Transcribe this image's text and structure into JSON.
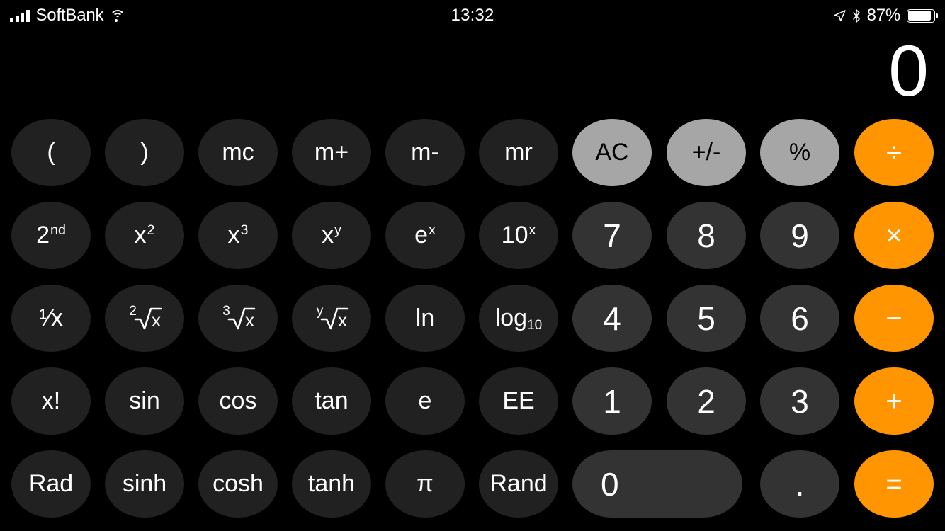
{
  "status_bar": {
    "carrier": "SoftBank",
    "time": "13:32",
    "battery_percent": "87%",
    "icons": [
      "signal-bars-icon",
      "wifi-icon",
      "location-arrow-icon",
      "bluetooth-icon",
      "battery-icon"
    ]
  },
  "display": {
    "value": "0"
  },
  "colors": {
    "background": "#000000",
    "function_key": "#212121",
    "number_key": "#333333",
    "utility_key": "#a6a6a6",
    "operator_key": "#ff9500",
    "text": "#ffffff"
  },
  "keypad": {
    "rows": [
      [
        {
          "label": "(",
          "name": "key-open-paren",
          "type": "fn"
        },
        {
          "label": ")",
          "name": "key-close-paren",
          "type": "fn"
        },
        {
          "label": "mc",
          "name": "key-memory-clear",
          "type": "fn"
        },
        {
          "label": "m+",
          "name": "key-memory-add",
          "type": "fn"
        },
        {
          "label": "m-",
          "name": "key-memory-subtract",
          "type": "fn"
        },
        {
          "label": "mr",
          "name": "key-memory-recall",
          "type": "fn"
        },
        {
          "label": "AC",
          "name": "key-all-clear",
          "type": "gray"
        },
        {
          "label": "+/-",
          "name": "key-plus-minus",
          "type": "gray"
        },
        {
          "label": "%",
          "name": "key-percent",
          "type": "gray"
        },
        {
          "label": "÷",
          "name": "key-divide",
          "type": "op"
        }
      ],
      [
        {
          "label": "2nd",
          "name": "key-second",
          "type": "fn",
          "sup": "nd",
          "base": "2"
        },
        {
          "label": "x2",
          "name": "key-x-squared",
          "type": "fn",
          "sup": "2",
          "base": "x"
        },
        {
          "label": "x3",
          "name": "key-x-cubed",
          "type": "fn",
          "sup": "3",
          "base": "x"
        },
        {
          "label": "xy",
          "name": "key-x-power-y",
          "type": "fn",
          "sup": "y",
          "base": "x"
        },
        {
          "label": "ex",
          "name": "key-e-power-x",
          "type": "fn",
          "sup": "x",
          "base": "e"
        },
        {
          "label": "10x",
          "name": "key-ten-power-x",
          "type": "fn",
          "sup": "x",
          "base": "10"
        },
        {
          "label": "7",
          "name": "key-7",
          "type": "num"
        },
        {
          "label": "8",
          "name": "key-8",
          "type": "num"
        },
        {
          "label": "9",
          "name": "key-9",
          "type": "num"
        },
        {
          "label": "×",
          "name": "key-multiply",
          "type": "op"
        }
      ],
      [
        {
          "label": "1/x",
          "name": "key-reciprocal",
          "type": "fn",
          "frac": "¹⁄x"
        },
        {
          "label": "2√x",
          "name": "key-square-root",
          "type": "fn",
          "radical": true,
          "index": "2"
        },
        {
          "label": "3√x",
          "name": "key-cube-root",
          "type": "fn",
          "radical": true,
          "index": "3"
        },
        {
          "label": "y√x",
          "name": "key-y-root",
          "type": "fn",
          "radical": true,
          "index": "y"
        },
        {
          "label": "ln",
          "name": "key-natural-log",
          "type": "fn"
        },
        {
          "label": "log10",
          "name": "key-log-base-10",
          "type": "fn",
          "sub": "10",
          "base": "log"
        },
        {
          "label": "4",
          "name": "key-4",
          "type": "num"
        },
        {
          "label": "5",
          "name": "key-5",
          "type": "num"
        },
        {
          "label": "6",
          "name": "key-6",
          "type": "num"
        },
        {
          "label": "−",
          "name": "key-subtract",
          "type": "op"
        }
      ],
      [
        {
          "label": "x!",
          "name": "key-factorial",
          "type": "fn"
        },
        {
          "label": "sin",
          "name": "key-sin",
          "type": "fn"
        },
        {
          "label": "cos",
          "name": "key-cos",
          "type": "fn"
        },
        {
          "label": "tan",
          "name": "key-tan",
          "type": "fn"
        },
        {
          "label": "e",
          "name": "key-euler-e",
          "type": "fn"
        },
        {
          "label": "EE",
          "name": "key-exponent-ee",
          "type": "fn"
        },
        {
          "label": "1",
          "name": "key-1",
          "type": "num"
        },
        {
          "label": "2",
          "name": "key-2",
          "type": "num"
        },
        {
          "label": "3",
          "name": "key-3",
          "type": "num"
        },
        {
          "label": "+",
          "name": "key-add",
          "type": "op"
        }
      ],
      [
        {
          "label": "Rad",
          "name": "key-rad",
          "type": "fn"
        },
        {
          "label": "sinh",
          "name": "key-sinh",
          "type": "fn"
        },
        {
          "label": "cosh",
          "name": "key-cosh",
          "type": "fn"
        },
        {
          "label": "tanh",
          "name": "key-tanh",
          "type": "fn"
        },
        {
          "label": "π",
          "name": "key-pi",
          "type": "fn"
        },
        {
          "label": "Rand",
          "name": "key-rand",
          "type": "fn"
        },
        {
          "label": "0",
          "name": "key-0",
          "type": "num",
          "wide": true
        },
        {
          "label": ".",
          "name": "key-decimal-point",
          "type": "num"
        },
        {
          "label": "=",
          "name": "key-equals",
          "type": "op"
        }
      ]
    ]
  }
}
